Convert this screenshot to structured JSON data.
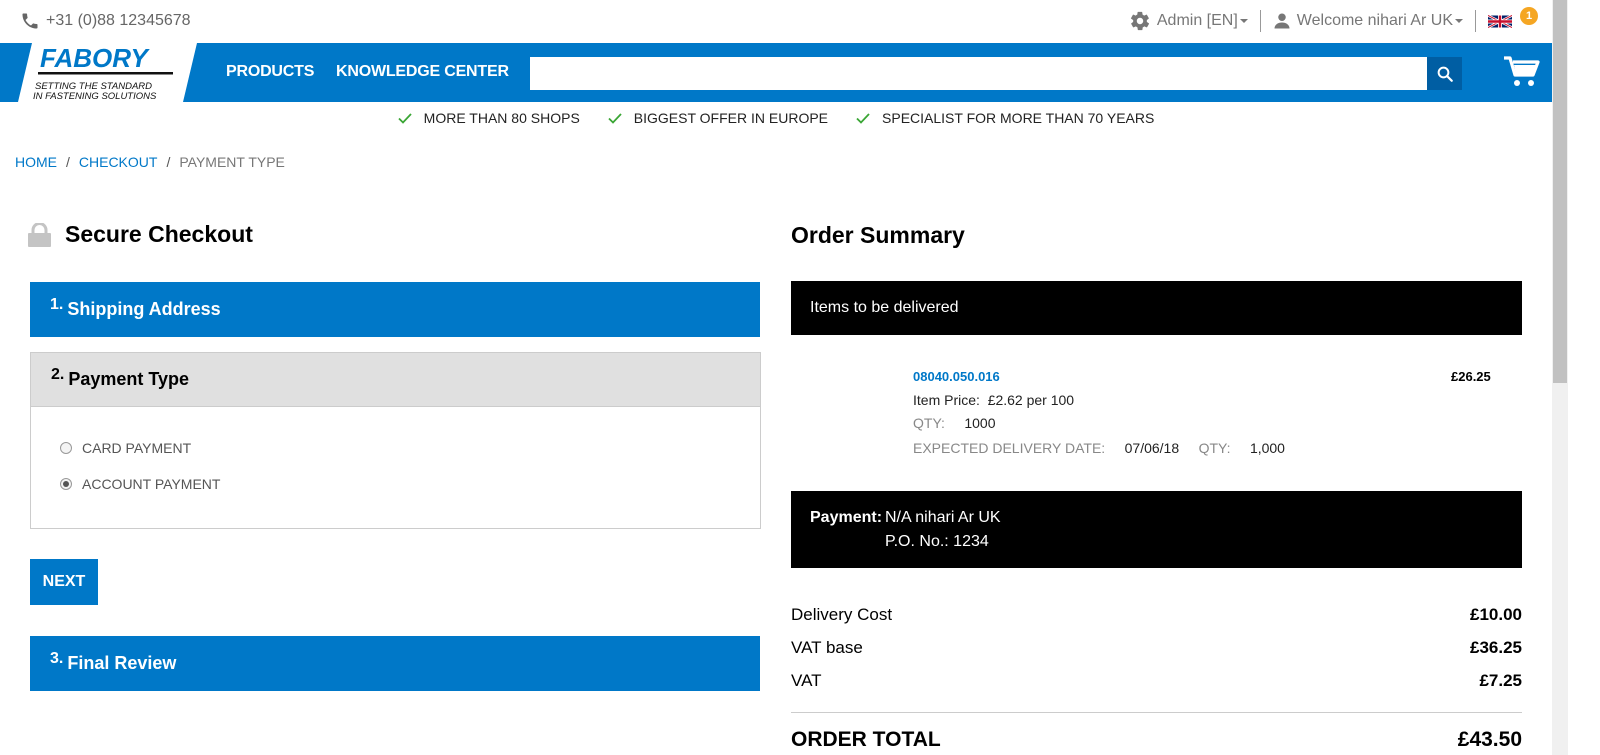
{
  "topbar": {
    "phone": "+31 (0)88 12345678",
    "admin_label": "Admin [EN]",
    "welcome_label": "Welcome nihari Ar UK",
    "language_flag": "UK flag"
  },
  "nav": {
    "logo_text": "FABORY",
    "logo_tagline_1": "SETTING THE STANDARD",
    "logo_tagline_2": "IN FASTENING SOLUTIONS",
    "products": "PRODUCTS",
    "knowledge": "KNOWLEDGE CENTER",
    "search_placeholder": "",
    "cart_count": "1"
  },
  "usp": [
    "MORE THAN 80 SHOPS",
    "BIGGEST OFFER IN EUROPE",
    "SPECIALIST FOR MORE THAN 70 YEARS"
  ],
  "breadcrumb": {
    "home": "HOME",
    "checkout": "CHECKOUT",
    "current": "PAYMENT TYPE",
    "sep": "/"
  },
  "checkout": {
    "title": "Secure Checkout",
    "step1_num": "1.",
    "step1_label": "Shipping Address",
    "step2_num": "2.",
    "step2_label": "Payment Type",
    "step3_num": "3.",
    "step3_label": "Final Review",
    "option_card": "CARD PAYMENT",
    "option_account": "ACCOUNT PAYMENT",
    "selected_option": "ACCOUNT PAYMENT",
    "next": "NEXT"
  },
  "summary": {
    "title": "Order Summary",
    "items_header": "Items to be delivered",
    "item": {
      "code": "08040.050.016",
      "price": "£26.25",
      "item_price_label": "Item Price:",
      "item_price_value": "£2.62  per 100",
      "qty_label": "QTY:",
      "qty_value": "1000",
      "delivery_label": "EXPECTED DELIVERY DATE:",
      "delivery_value": "07/06/18",
      "qty2_label": "QTY:",
      "qty2_value": "1,000"
    },
    "payment_label": "Payment:",
    "payment_value": "N/A nihari Ar UK",
    "po_line": "P.O. No.: 1234",
    "delivery_cost_label": "Delivery Cost",
    "delivery_cost_value": "£10.00",
    "vat_base_label": "VAT base",
    "vat_base_value": "£36.25",
    "vat_label": "VAT",
    "vat_value": "£7.25",
    "order_total_label": "ORDER TOTAL",
    "order_total_value": "£43.50"
  },
  "colors": {
    "brand_blue": "#0078c8",
    "badge": "#f5a623",
    "check_green": "#3aa635"
  }
}
